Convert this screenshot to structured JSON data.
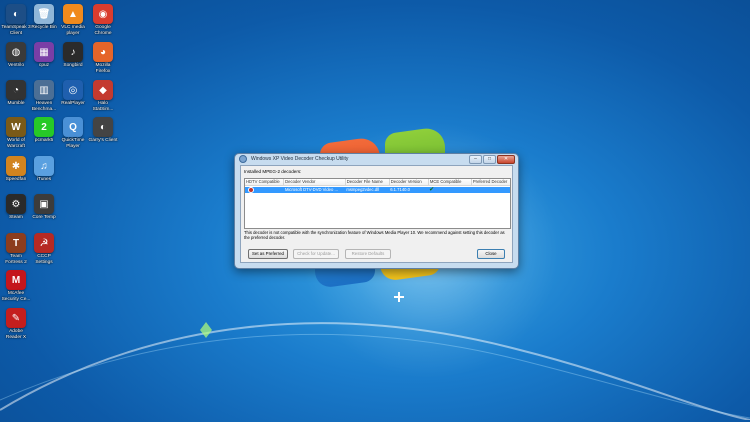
{
  "desktop": {
    "icons": [
      {
        "label": "TeamSpeak 3\nClient",
        "icon": "teamspeak-icon",
        "color": "#1d4e86",
        "glyph": "◐"
      },
      {
        "label": "Recycle Bin",
        "icon": "recycle-bin-icon",
        "color": "#8fb6d8",
        "glyph": "🗑"
      },
      {
        "label": "VLC media\nplayer",
        "icon": "vlc-icon",
        "color": "#f08a1d",
        "glyph": "▲"
      },
      {
        "label": "Google\nChrome",
        "icon": "chrome-icon",
        "color": "#d93c2e",
        "glyph": "◉"
      },
      {
        "label": "Ventrilo",
        "icon": "ventrilo-icon",
        "color": "#3a3a3a",
        "glyph": "◍"
      },
      {
        "label": "cpuz",
        "icon": "cpuz-icon",
        "color": "#7a3ea6",
        "glyph": "▦"
      },
      {
        "label": "Songbird",
        "icon": "songbird-icon",
        "color": "#2b2b2b",
        "glyph": "♪"
      },
      {
        "label": "Mozilla\nFirefox",
        "icon": "firefox-icon",
        "color": "#e5652a",
        "glyph": "◕"
      },
      {
        "label": "Mumble",
        "icon": "mumble-icon",
        "color": "#333333",
        "glyph": "◔"
      },
      {
        "label": "Heaven\nBenchma...",
        "icon": "heaven-benchmark-icon",
        "color": "#4c6f95",
        "glyph": "▥"
      },
      {
        "label": "RealPlayer",
        "icon": "realplayer-icon",
        "color": "#1f5fae",
        "glyph": "◎"
      },
      {
        "label": "Halo\nStatSim...",
        "icon": "halo-icon",
        "color": "#c43a2f",
        "glyph": "◆"
      },
      {
        "label": "World of\nWarcraft",
        "icon": "wow-icon",
        "color": "#7a5a18",
        "glyph": "W"
      },
      {
        "label": "pcmark5",
        "icon": "pcmark-icon",
        "color": "#27c927",
        "glyph": "2"
      },
      {
        "label": "QuickTime\nPlayer",
        "icon": "quicktime-icon",
        "color": "#4a90d6",
        "glyph": "Q"
      },
      {
        "label": "Garry's Client",
        "icon": "garrys-icon",
        "color": "#444444",
        "glyph": "◐"
      },
      {
        "label": "Speedfan",
        "icon": "speedfan-icon",
        "color": "#d2841f",
        "glyph": "✱"
      },
      {
        "label": "iTunes",
        "icon": "itunes-icon",
        "color": "#5aa0e0",
        "glyph": "♫"
      },
      {
        "label": "Steam",
        "icon": "steam-icon",
        "color": "#2a2a2a",
        "glyph": "⚙"
      },
      {
        "label": "Core Temp",
        "icon": "coretemp-icon",
        "color": "#3c3c3c",
        "glyph": "▣"
      },
      {
        "label": "Team\nFortress 2",
        "icon": "tf2-icon",
        "color": "#8c3d1e",
        "glyph": "T"
      },
      {
        "label": "CCCP\nSettings",
        "icon": "cccp-icon",
        "color": "#b62a24",
        "glyph": "☭"
      },
      {
        "label": "McAfee\nSecurity Ce...",
        "icon": "mcafee-icon",
        "color": "#c4161c",
        "glyph": "M"
      },
      {
        "label": "Adobe\nReader X",
        "icon": "adobe-reader-icon",
        "color": "#c41e1e",
        "glyph": "✎"
      }
    ]
  },
  "dialog": {
    "title": "Windows XP Video Decoder Checkup Utility",
    "minimize": "–",
    "maximize": "□",
    "close": "✕",
    "section_label": "Installed MPEG-2 decoders:",
    "columns": [
      "HDTV Compatible",
      "Decoder Vendor",
      "Decoder File Name",
      "Decoder Version",
      "MCE Compatible",
      "Preferred Decoder"
    ],
    "row": {
      "vendor": "Microsoft DTV-DVD Video ...",
      "file": "msmpeg2vdec.dll",
      "version": "6.1.7140.0",
      "mce_check": "✔"
    },
    "message": "This decoder is not compatible with the synchronization feature of Windows Media Player 10. We recommend against setting this decoder as the preferred decoder.",
    "buttons": {
      "set_preferred": "Set as Preferred",
      "check_update": "Check for Update...",
      "restore_defaults": "Restore Defaults",
      "close": "Close"
    }
  }
}
